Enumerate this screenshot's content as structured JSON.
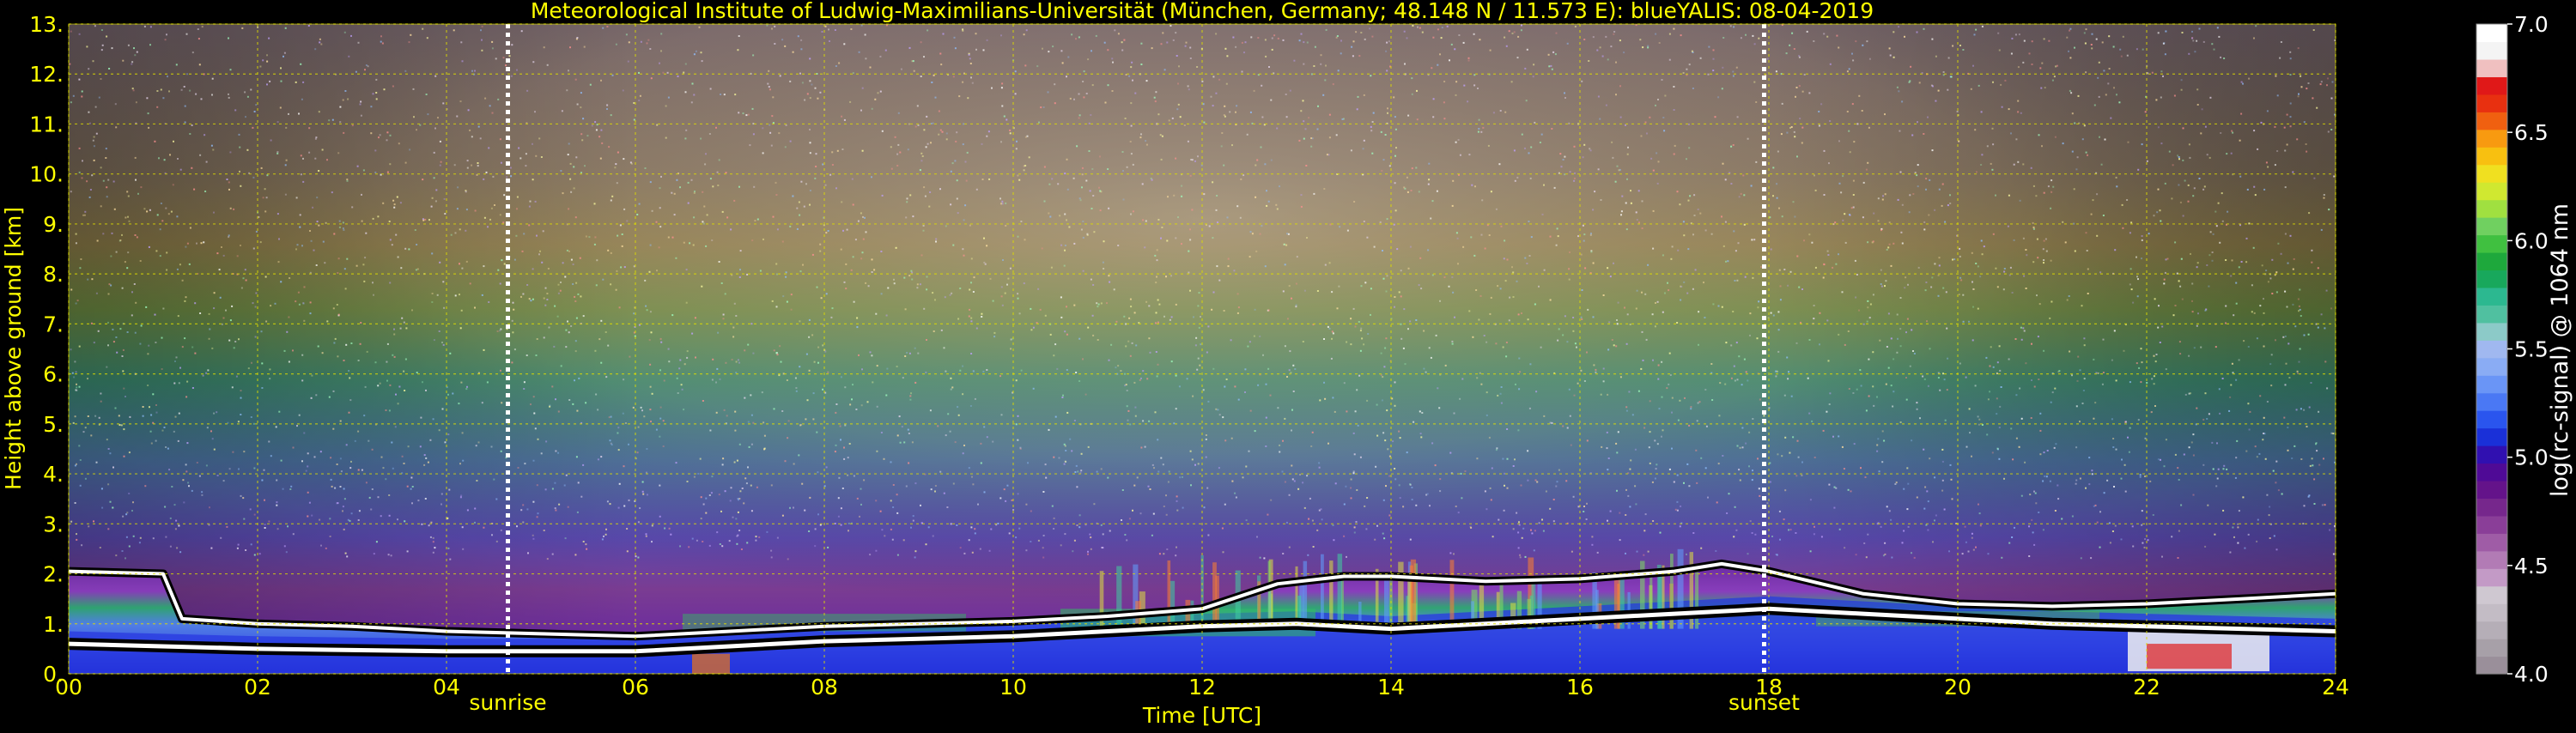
{
  "chart_data": {
    "type": "heatmap",
    "title": "Meteorological Institute of Ludwig-Maximilians-Universität (München, Germany; 48.148 N / 11.573 E):    blueYALIS: 08-04-2019",
    "xlabel": "Time [UTC]",
    "ylabel": "Height above ground [km]",
    "xlim": [
      0,
      24
    ],
    "ylim": [
      0,
      13
    ],
    "x_ticks": [
      "00",
      "02",
      "04",
      "06",
      "08",
      "10",
      "12",
      "14",
      "16",
      "18",
      "20",
      "22",
      "24"
    ],
    "y_ticks": [
      "0.",
      "1.",
      "2.",
      "3.",
      "4.",
      "5.",
      "6.",
      "7.",
      "8.",
      "9.",
      "10.",
      "11.",
      "12.",
      "13."
    ],
    "grid": true,
    "events": [
      {
        "label": "sunrise",
        "time": 4.65
      },
      {
        "label": "sunset",
        "time": 17.95
      }
    ],
    "colorbar": {
      "label": "log(rc-signal) @ 1064 nm",
      "range": [
        4.0,
        7.0
      ],
      "ticks": [
        "4.0",
        "4.5",
        "5.0",
        "5.5",
        "6.0",
        "6.5",
        "7.0"
      ],
      "colors": [
        "#9a8f9a",
        "#a7a0a8",
        "#b5aeb7",
        "#c3bcc5",
        "#cfc8d1",
        "#c39ac6",
        "#b27bb5",
        "#9f5ca6",
        "#8a3e98",
        "#76278c",
        "#64138a",
        "#4f0a96",
        "#3010b0",
        "#1a30d8",
        "#2a55ee",
        "#4a78f4",
        "#6a95f6",
        "#8aacf4",
        "#a0b8f0",
        "#8ccac8",
        "#50c0a0",
        "#2cb890",
        "#18a85c",
        "#1ea83c",
        "#40c040",
        "#70d060",
        "#a0e040",
        "#d0e830",
        "#f0e020",
        "#f8c010",
        "#f89a10",
        "#f06010",
        "#e83010",
        "#e01818",
        "#f0c0c0",
        "#f4f4f4",
        "#ffffff"
      ]
    },
    "layers": [
      {
        "name": "aerosol layer top (white/black)",
        "points": [
          [
            0,
            2.05
          ],
          [
            1,
            2.0
          ],
          [
            1.2,
            1.1
          ],
          [
            2,
            1.0
          ],
          [
            3,
            0.95
          ],
          [
            4,
            0.85
          ],
          [
            5,
            0.8
          ],
          [
            6,
            0.75
          ],
          [
            7,
            0.85
          ],
          [
            8,
            0.95
          ],
          [
            9,
            1.0
          ],
          [
            10,
            1.05
          ],
          [
            11,
            1.15
          ],
          [
            12,
            1.3
          ],
          [
            12.8,
            1.8
          ],
          [
            13.5,
            1.95
          ],
          [
            14,
            1.95
          ],
          [
            15,
            1.85
          ],
          [
            16,
            1.9
          ],
          [
            17,
            2.05
          ],
          [
            17.5,
            2.2
          ],
          [
            18,
            2.05
          ],
          [
            19,
            1.6
          ],
          [
            20,
            1.4
          ],
          [
            21,
            1.35
          ],
          [
            22,
            1.4
          ],
          [
            23,
            1.5
          ],
          [
            24,
            1.6
          ]
        ]
      },
      {
        "name": "low layer (black/white)",
        "points": [
          [
            0,
            0.6
          ],
          [
            2,
            0.5
          ],
          [
            4,
            0.45
          ],
          [
            6,
            0.45
          ],
          [
            7,
            0.55
          ],
          [
            8,
            0.65
          ],
          [
            9,
            0.7
          ],
          [
            10,
            0.75
          ],
          [
            11,
            0.85
          ],
          [
            12,
            0.95
          ],
          [
            13,
            1.0
          ],
          [
            14,
            0.9
          ],
          [
            15,
            1.0
          ],
          [
            16,
            1.1
          ],
          [
            17,
            1.2
          ],
          [
            18,
            1.3
          ],
          [
            19,
            1.2
          ],
          [
            20,
            1.1
          ],
          [
            21,
            1.0
          ],
          [
            22,
            0.95
          ],
          [
            23,
            0.9
          ],
          [
            24,
            0.85
          ]
        ]
      }
    ]
  }
}
